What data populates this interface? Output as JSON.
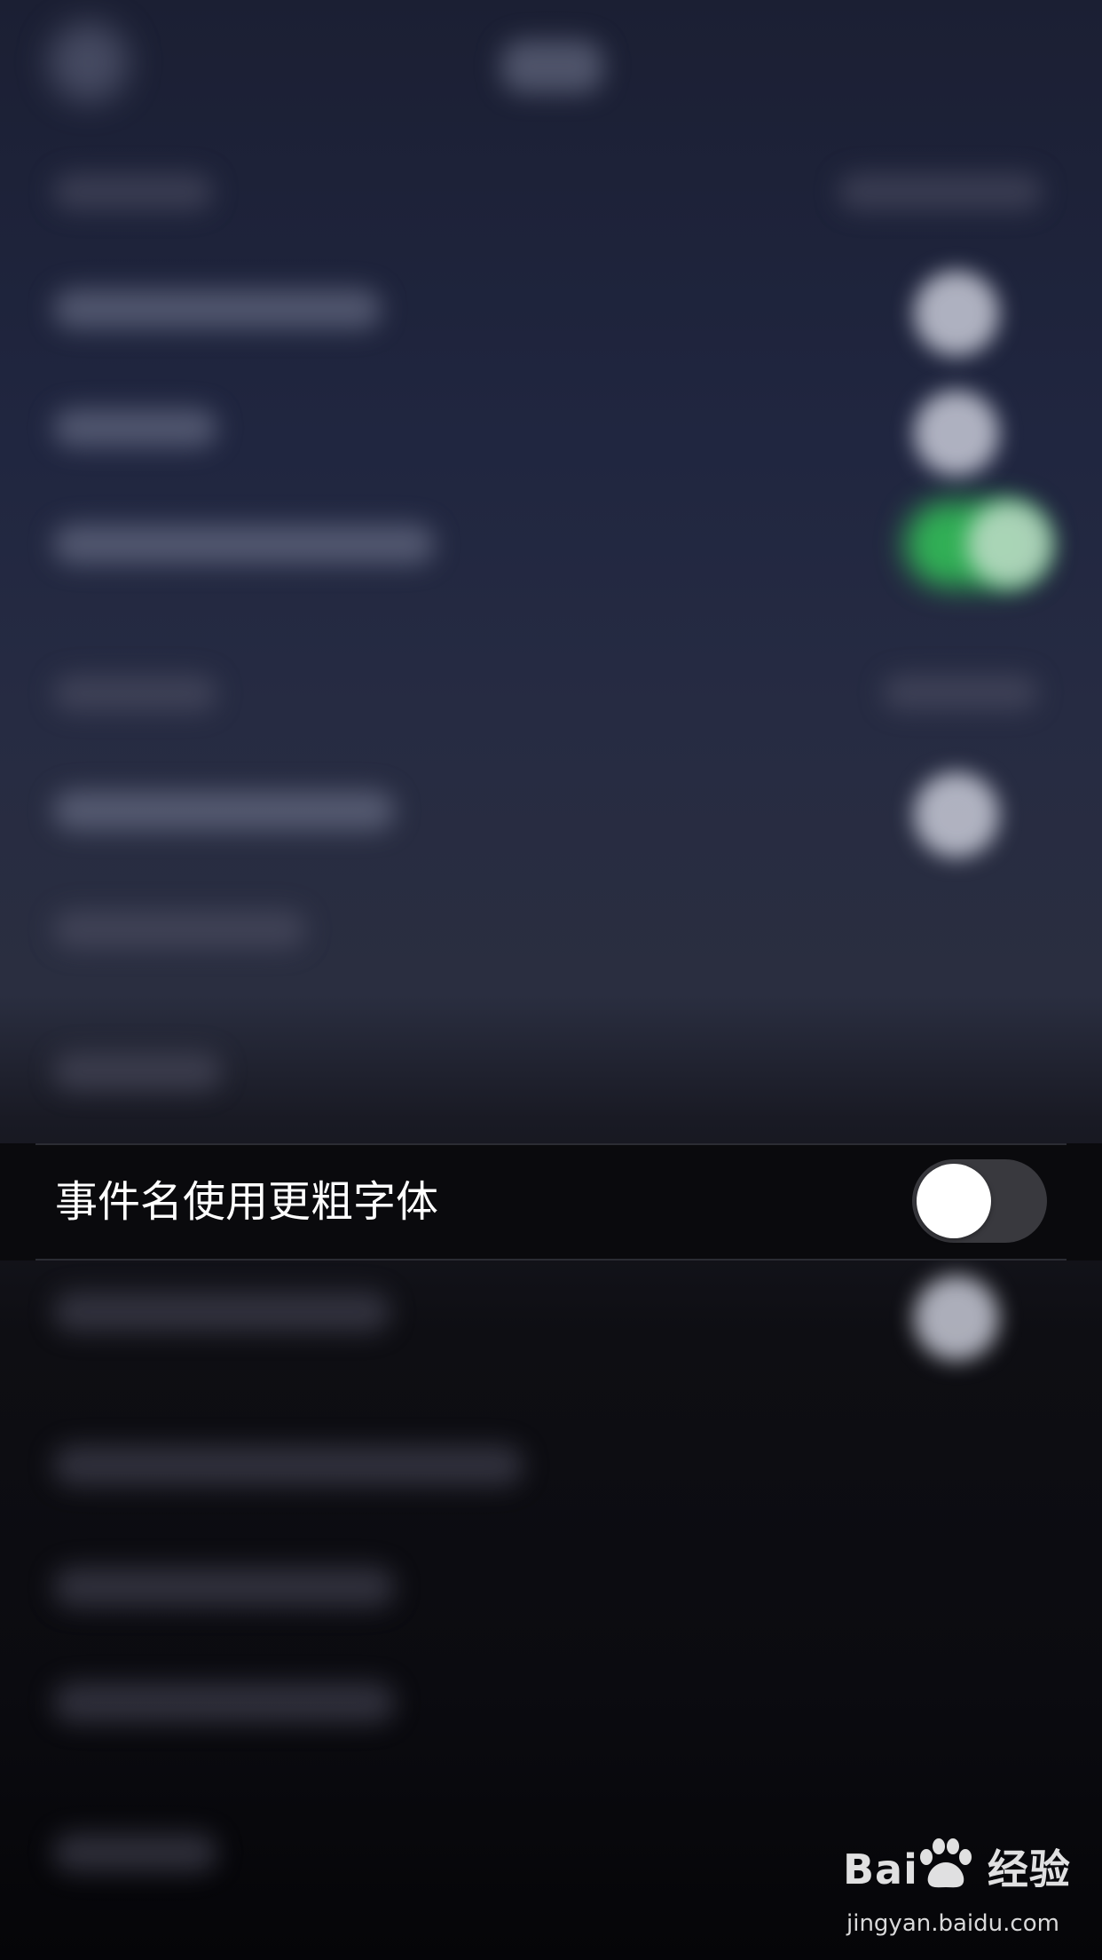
{
  "focused_setting": {
    "label": "事件名使用更粗字体",
    "toggle_on": false
  },
  "watermark": {
    "logo_left": "Bai",
    "logo_right": "经验",
    "url": "jingyan.baidu.com"
  },
  "colors": {
    "toggle_off_track": "#39393e",
    "toggle_thumb": "#ffffff",
    "toggle_on_green": "#34c759",
    "row_background": "#0a0a0d"
  },
  "icons": [
    "baidu-paw-icon"
  ]
}
